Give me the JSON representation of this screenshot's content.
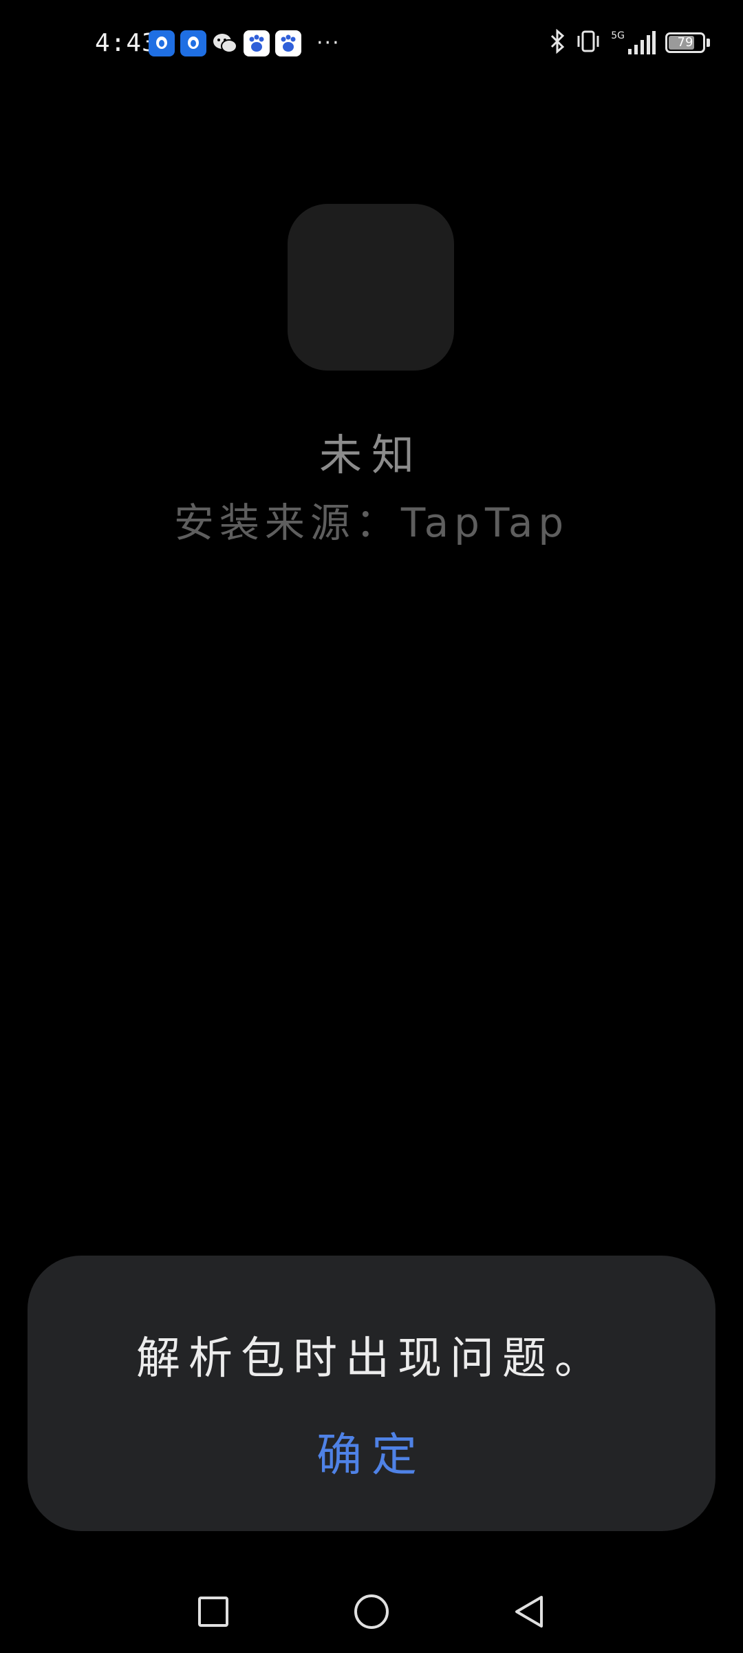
{
  "status_bar": {
    "time": "4:43",
    "notification_icons": [
      "qq-icon",
      "qq-icon",
      "wechat-icon",
      "baidu-icon",
      "baidu-icon"
    ],
    "more": "···",
    "network": "5G",
    "battery_level": "79",
    "battery_fraction": 0.79
  },
  "app": {
    "name": "未知",
    "install_source": "安装来源：TapTap"
  },
  "dialog": {
    "message": "解析包时出现问题。",
    "confirm_label": "确定"
  },
  "colors": {
    "background": "#000000",
    "dialog_bg": "#232426",
    "accent": "#4f82e6",
    "app_name": "#8c8c8c",
    "install_source": "#5e5e5e"
  },
  "nav_bar": {
    "buttons": [
      "recents-button",
      "home-button",
      "back-button"
    ]
  }
}
